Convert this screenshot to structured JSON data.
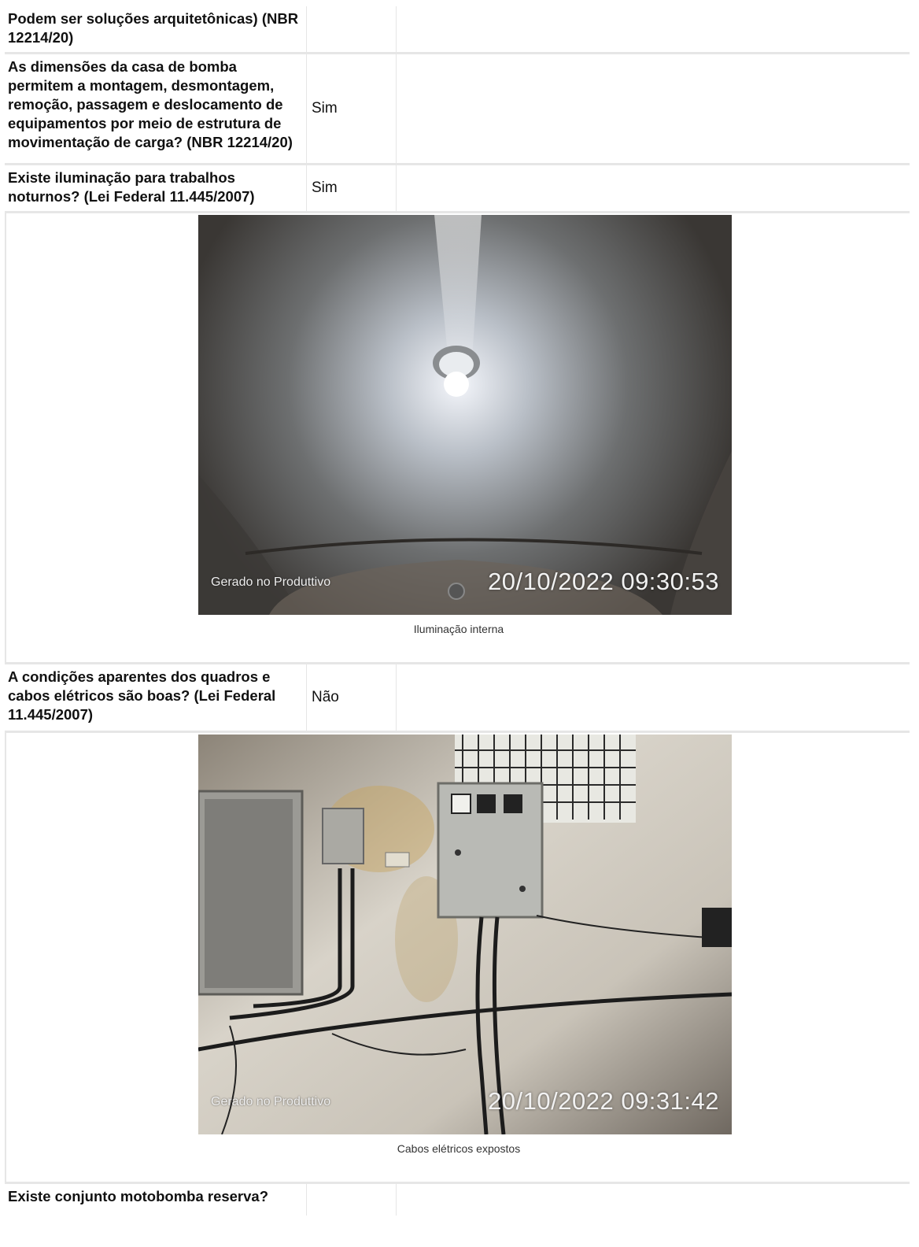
{
  "rows": [
    {
      "question": "Podem ser soluções arquitetônicas) (NBR 12214/20)",
      "answer": ""
    },
    {
      "question": "As dimensões da casa de bomba permitem a montagem, desmontagem, remoção, passagem e deslocamento de equipamentos por meio de estrutura de movimentação de carga? (NBR 12214/20)",
      "answer": "Sim"
    },
    {
      "question": "Existe iluminação para trabalhos noturnos? (Lei Federal 11.445/2007)",
      "answer": "Sim"
    },
    {
      "question": "A condições aparentes dos quadros e cabos elétricos são boas? (Lei Federal 11.445/2007)",
      "answer": "Não"
    },
    {
      "question": "Existe conjunto motobomba reserva?",
      "answer": ""
    }
  ],
  "photos": [
    {
      "watermark": "Gerado no Produttivo",
      "timestamp": "20/10/2022 09:30:53",
      "caption": "Iluminação interna"
    },
    {
      "watermark": "Gerado no Produttivo",
      "timestamp": "20/10/2022 09:31:42",
      "caption": "Cabos elétricos expostos"
    }
  ]
}
